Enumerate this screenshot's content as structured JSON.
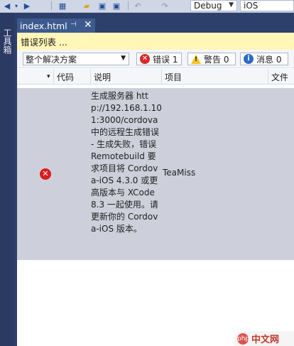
{
  "toolbar": {
    "config_value": "Debug",
    "platform_value": "iOS"
  },
  "toolbox": {
    "label": "工具箱"
  },
  "tab": {
    "title": "index.html",
    "pin_glyph": "⊣",
    "close_glyph": "✕"
  },
  "error_list": {
    "title": "错误列表 ...",
    "scope_value": "整个解决方案",
    "errors_label": "错误 1",
    "warnings_label": "警告 0",
    "messages_label": "消息 0",
    "columns": {
      "code": "代码",
      "description": "说明",
      "project": "项目",
      "file": "文件"
    },
    "rows": [
      {
        "description": "生成服务器 http://192.168.1.101:3000/cordova 中的远程生成错误 - 生成失败，错误 Remotebuild 要求项目将 Cordova-iOS 4.3.0 或更高版本与 XCode 8.3 一起使用。请更新你的 Cordova-iOS 版本。",
        "project": "TeaMiss"
      }
    ]
  },
  "watermark": {
    "text": "中文网",
    "logo": "php"
  },
  "colors": {
    "accent": "#3d5a8f",
    "error": "#d72929",
    "warning": "#f3c327",
    "info": "#2b6cc4",
    "title_bar": "#fff6b8",
    "selected_row": "#cdd0da"
  }
}
